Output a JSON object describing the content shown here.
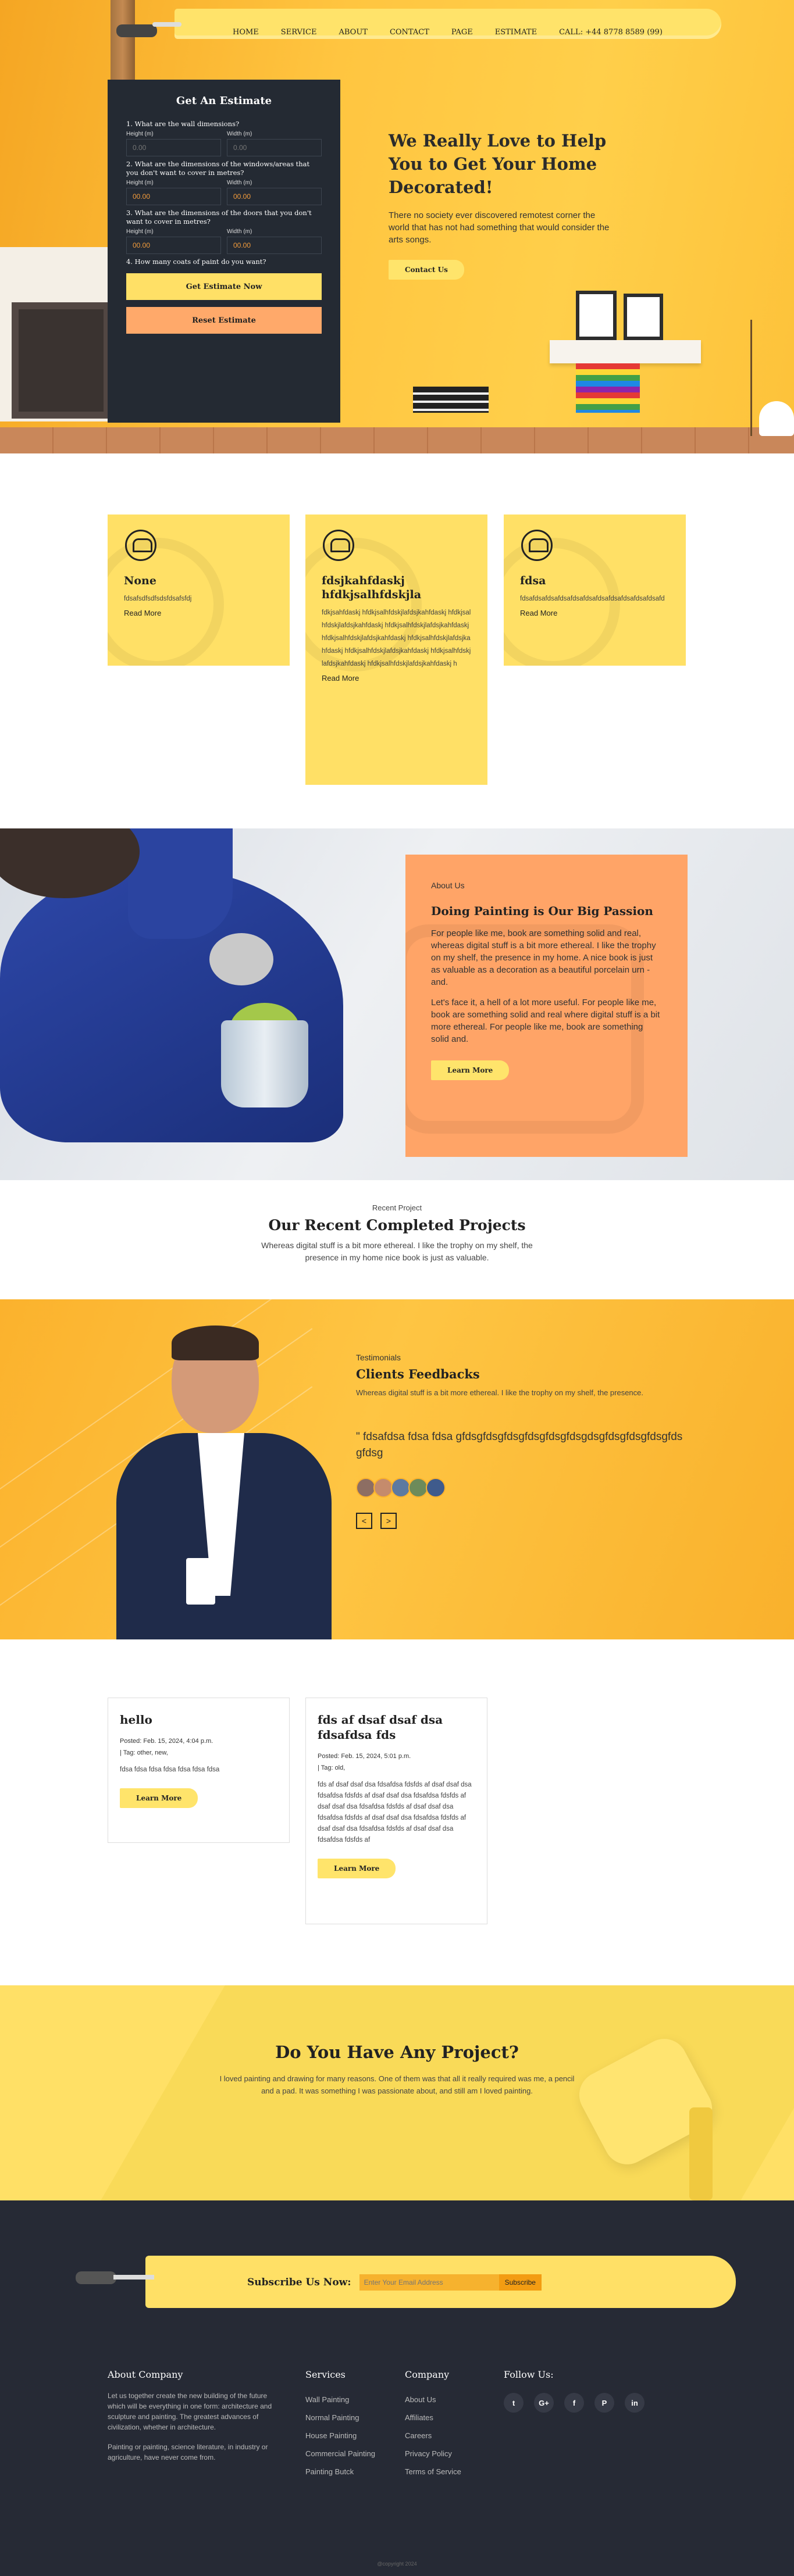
{
  "nav": {
    "items": [
      "HOME",
      "SERVICE",
      "ABOUT",
      "CONTACT",
      "PAGE",
      "ESTIMATE"
    ],
    "call": "CALL: +44 8778 8589 (99)"
  },
  "estimate": {
    "title": "Get An Estimate",
    "q1": "1. What are the wall dimensions?",
    "q2": "2. What are the dimensions of the windows/areas that you don't want to cover in metres?",
    "q3": "3. What are the dimensions of the doors that you don't want to cover in metres?",
    "q4": "4. How many coats of paint do you want?",
    "height_label": "Height (m)",
    "width_label": "Width (m)",
    "placeholder_zero": "0.00",
    "value_zero": "00.00",
    "btn_estimate": "Get Estimate Now",
    "btn_reset": "Reset Estimate"
  },
  "hero": {
    "title": "We Really Love to Help You to Get Your Home Decorated!",
    "text": "There no society ever discovered remotest corner the world that has not had something that would consider the arts songs.",
    "btn": "Contact Us"
  },
  "services": [
    {
      "title": "None",
      "text": "fdsafsdfsdfsdsfdsafsfdj",
      "link": "Read More"
    },
    {
      "title": "fdsjkahfdaskj hfdkjsalhfdskjla",
      "text": "fdkjsahfdaskj hfdkjsalhfdskjlafdsjkahfdaskj hfdkjsalhfdskjlafdsjkahfdaskj hfdkjsalhfdskjlafdsjkahfdaskj hfdkjsalhfdskjlafdsjkahfdaskj hfdkjsalhfdskjlafdsjkahfdaskj hfdkjsalhfdskjlafdsjkahfdaskj hfdkjsalhfdskjlafdsjkahfdaskj hfdkjsalhfdskjlafdsjkahfdaskj h",
      "link": "Read More"
    },
    {
      "title": "fdsa",
      "text": "fdsafdsafdsafdsafdsafdsafdsafdsafdsafdsafdsafd",
      "link": "Read More"
    }
  ],
  "about": {
    "tag": "About Us",
    "title": "Doing Painting is Our Big Passion",
    "p1": "For people like me, book are something solid and real, whereas digital stuff is a bit more ethereal. I like the trophy on my shelf, the presence in my home. A nice book is just as valuable as a decoration as a beautiful porcelain urn - and.",
    "p2": "Let's face it, a hell of a lot more useful. For people like me, book are something solid and real where digital stuff is a bit more ethereal. For people like me, book are something solid and.",
    "btn": "Learn More"
  },
  "projects": {
    "tag": "Recent Project",
    "title": "Our Recent Completed Projects",
    "text": "Whereas digital stuff is a bit more ethereal. I like the trophy on my shelf, the presence in my home nice book is just as valuable."
  },
  "testimonials": {
    "tag": "Testimonials",
    "title": "Clients Feedbacks",
    "sub": "Whereas digital stuff is a bit more ethereal. I like the trophy on my shelf, the presence.",
    "quote": "\" fdsafdsa fdsa fdsa gfdsgfdsgfdsgfdsgfdsgfdsgdsgfdsgfdsgfdsgfdsgfdsg",
    "prev": "<",
    "next": ">",
    "avatar_colors": [
      "#8d6e63",
      "#c58b6c",
      "#5d7aa0",
      "#6d8b5a",
      "#3f5b8c"
    ]
  },
  "posts": [
    {
      "title": "hello",
      "meta1": "Posted: Feb. 15, 2024, 4:04 p.m.",
      "meta2": "| Tag: other, new,",
      "body": "fdsa fdsa fdsa fdsa fdsa fdsa fdsa",
      "btn": "Learn More"
    },
    {
      "title": "fds af dsaf dsaf dsa fdsafdsa fds",
      "meta1": "Posted: Feb. 15, 2024, 5:01 p.m.",
      "meta2": "| Tag: old,",
      "body": "fds af dsaf dsaf dsa fdsafdsa fdsfds af dsaf dsaf dsa fdsafdsa fdsfds af dsaf dsaf dsa fdsafdsa fdsfds af dsaf dsaf dsa fdsafdsa fdsfds af dsaf dsaf dsa fdsafdsa fdsfds af dsaf dsaf dsa fdsafdsa fdsfds af dsaf dsaf dsa fdsafdsa fdsfds af dsaf dsaf dsa fdsafdsa fdsfds af",
      "btn": "Learn More"
    }
  ],
  "cta": {
    "title": "Do You Have Any Project?",
    "text": "I loved painting and drawing for many reasons. One of them was that all it really required was me, a pencil and a pad. It was something I was passionate about, and still am I loved painting."
  },
  "footer": {
    "subscribe_label": "Subscribe Us Now:",
    "email_placeholder": "Enter Your Email Address",
    "subscribe_btn": "Subscribe",
    "about_title": "About Company",
    "about_p1": "Let us together create the new building of the future which will be everything in one form: architecture and sculpture and painting. The greatest advances of civilization, whether in architecture.",
    "about_p2": "Painting or painting, science literature, in industry or agriculture, have never come from.",
    "services_title": "Services",
    "services": [
      "Wall Painting",
      "Normal Painting",
      "House Painting",
      "Commercial Painting",
      "Painting Butck"
    ],
    "company_title": "Company",
    "company": [
      "About Us",
      "Affiliates",
      "Careers",
      "Privacy Policy",
      "Terms of Service"
    ],
    "follow_title": "Follow Us:",
    "social": [
      "t",
      "G+",
      "f",
      "P",
      "in"
    ],
    "copyright": "@copyright 2024"
  }
}
